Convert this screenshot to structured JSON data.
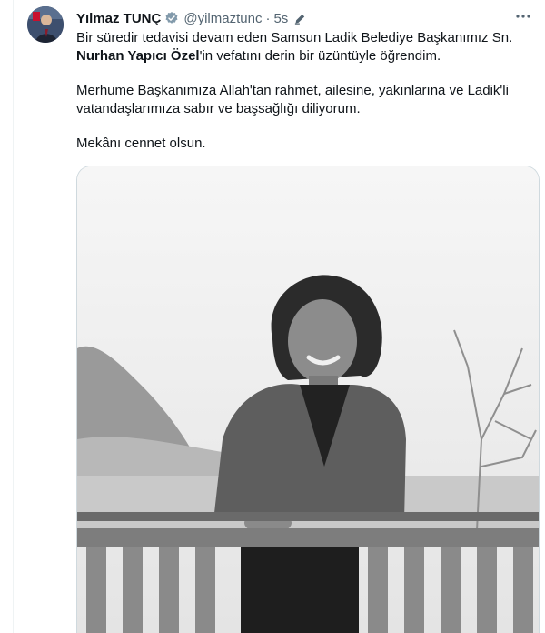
{
  "tweet": {
    "author_name": "Yılmaz TUNÇ",
    "handle": "@yilmaztunc",
    "separator": "·",
    "time": "5s",
    "text": {
      "line1_start": "Bir süredir tedavisi devam eden Samsun Ladik Belediye Başkanımız Sn.",
      "bold_name": "Nurhan Yapıcı Özel",
      "line2_rest": "'in vefatını derin bir üzüntüyle öğrendim.",
      "paragraph2": "Merhume Başkanımıza Allah'tan rahmet, ailesine, yakınlarına ve Ladik'li vatandaşlarımıza sabır ve başsağlığı diliyorum.",
      "paragraph3": "Mekânı cennet olsun."
    },
    "icons": {
      "verified": "verified-badge-icon",
      "edit": "pencil-icon",
      "more": "more-options-icon"
    },
    "colors": {
      "verified_badge": "#829aab",
      "secondary_text": "#536471"
    }
  }
}
